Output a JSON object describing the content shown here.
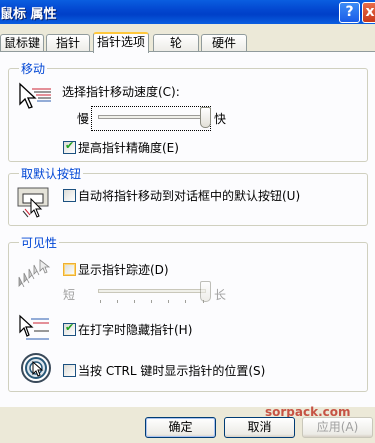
{
  "window": {
    "title": "鼠标 属性",
    "help_glyph": "?",
    "close_glyph": "x"
  },
  "tabs": [
    {
      "label": "鼠标键"
    },
    {
      "label": "指针"
    },
    {
      "label": "指针选项"
    },
    {
      "label": "轮"
    },
    {
      "label": "硬件"
    }
  ],
  "active_tab": "指针选项",
  "motion": {
    "title": "移动",
    "speed_label": "选择指针移动速度(C):",
    "slow": "慢",
    "fast": "快",
    "speed_level": 1.0,
    "precision_label": "提高指针精确度(E)",
    "precision_checked": true
  },
  "snap": {
    "title": "取默认按钮",
    "label": "自动将指针移动到对话框中的默认按钮(U)",
    "checked": false
  },
  "visibility": {
    "title": "可见性",
    "trails_label": "显示指针踪迹(D)",
    "trails_checked": false,
    "short": "短",
    "long": "长",
    "trails_level": 1.0,
    "hide_label": "在打字时隐藏指针(H)",
    "hide_checked": true,
    "ctrl_label": "当按 CTRL 键时显示指针的位置(S)",
    "ctrl_checked": false
  },
  "buttons": {
    "ok": "确定",
    "cancel": "取消",
    "apply": "应用(A)"
  },
  "watermark": "sorpack.com",
  "colors": {
    "group_title": "#0046d5",
    "titlebar": "#0a5ee0",
    "active_tab_accent": "#ffc83c"
  }
}
